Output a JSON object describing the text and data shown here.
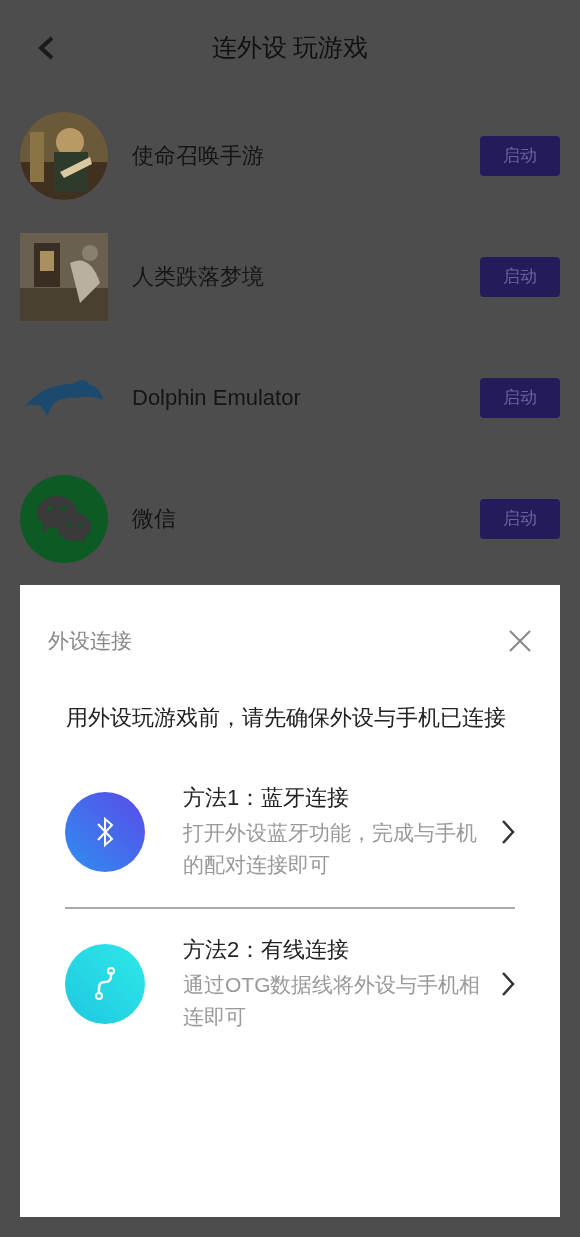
{
  "header": {
    "title": "连外设 玩游戏"
  },
  "apps": [
    {
      "name": "使命召唤手游",
      "button": "启动",
      "kind": "picture_round"
    },
    {
      "name": "人类跌落梦境",
      "button": "启动",
      "kind": "picture_square"
    },
    {
      "name": "Dolphin Emulator",
      "button": "启动",
      "kind": "dolphin"
    },
    {
      "name": "微信",
      "button": "启动",
      "kind": "wechat"
    }
  ],
  "dialog": {
    "title": "外设连接",
    "intro": "用外设玩游戏前，请先确保外设与手机已连接",
    "methods": [
      {
        "kind": "bluetooth",
        "title": "方法1：蓝牙连接",
        "description": "打开外设蓝牙功能，完成与手机的配对连接即可"
      },
      {
        "kind": "cable",
        "title": "方法2：有线连接",
        "description": "通过OTG数据线将外设与手机相连即可"
      }
    ]
  }
}
